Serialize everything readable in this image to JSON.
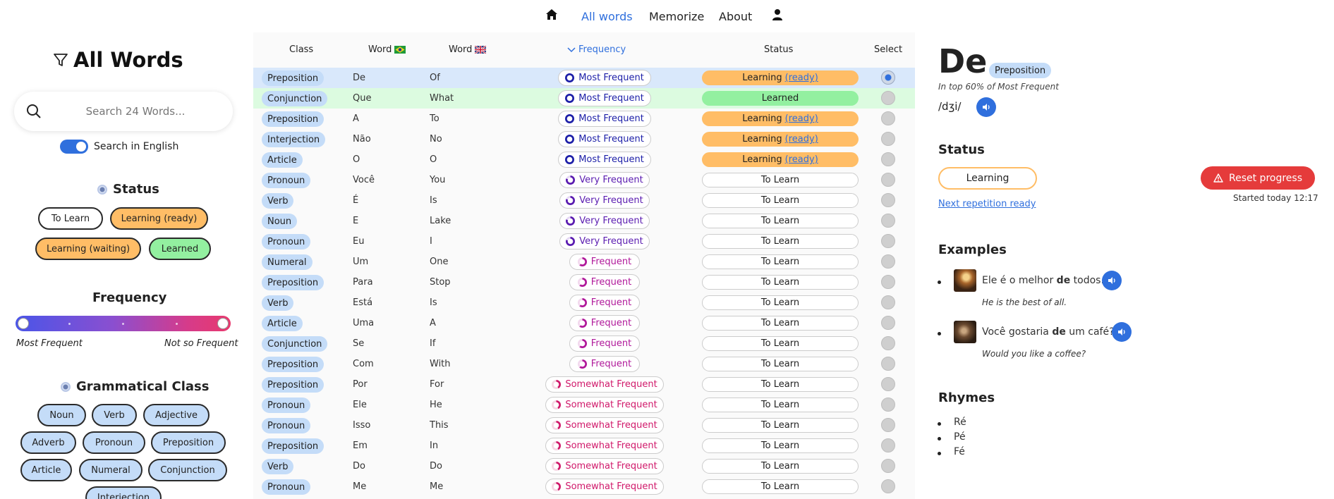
{
  "nav": {
    "home_icon": "home-icon",
    "links": [
      "All words",
      "Memorize",
      "About"
    ],
    "active": "All words",
    "user_icon": "user-icon"
  },
  "sidebar": {
    "title": "All Words",
    "title_icon": "filter-icon",
    "search_placeholder": "Search 24 Words...",
    "toggle_label": "Search in English",
    "toggle_on": true,
    "status_heading": "Status",
    "status_pills": [
      "To Learn",
      "Learning (ready)",
      "Learning (waiting)",
      "Learned"
    ],
    "frequency_heading": "Frequency",
    "frequency_min_label": "Most Frequent",
    "frequency_max_label": "Not so Frequent",
    "frequency_range": [
      0,
      1
    ],
    "class_heading": "Grammatical Class",
    "class_pills": [
      "Noun",
      "Verb",
      "Adjective",
      "Adverb",
      "Pronoun",
      "Preposition",
      "Article",
      "Numeral",
      "Conjunction",
      "Interjection"
    ]
  },
  "table": {
    "headers": {
      "class": "Class",
      "word_pt": "Word",
      "word_en": "Word",
      "frequency": "Frequency",
      "status": "Status",
      "select": "Select"
    },
    "rows": [
      {
        "class": "Preposition",
        "pt": "De",
        "en": "Of",
        "freq": "Most Frequent",
        "status": "Learning",
        "ready": "(ready)"
      },
      {
        "class": "Conjunction",
        "pt": "Que",
        "en": "What",
        "freq": "Most Frequent",
        "status": "Learned",
        "ready": ""
      },
      {
        "class": "Preposition",
        "pt": "A",
        "en": "To",
        "freq": "Most Frequent",
        "status": "Learning",
        "ready": "(ready)"
      },
      {
        "class": "Interjection",
        "pt": "Não",
        "en": "No",
        "freq": "Most Frequent",
        "status": "Learning",
        "ready": "(ready)"
      },
      {
        "class": "Article",
        "pt": "O",
        "en": "O",
        "freq": "Most Frequent",
        "status": "Learning",
        "ready": "(ready)"
      },
      {
        "class": "Pronoun",
        "pt": "Você",
        "en": "You",
        "freq": "Very Frequent",
        "status": "To Learn",
        "ready": ""
      },
      {
        "class": "Verb",
        "pt": "É",
        "en": "Is",
        "freq": "Very Frequent",
        "status": "To Learn",
        "ready": ""
      },
      {
        "class": "Noun",
        "pt": "E",
        "en": "Lake",
        "freq": "Very Frequent",
        "status": "To Learn",
        "ready": ""
      },
      {
        "class": "Pronoun",
        "pt": "Eu",
        "en": "I",
        "freq": "Very Frequent",
        "status": "To Learn",
        "ready": ""
      },
      {
        "class": "Numeral",
        "pt": "Um",
        "en": "One",
        "freq": "Frequent",
        "status": "To Learn",
        "ready": ""
      },
      {
        "class": "Preposition",
        "pt": "Para",
        "en": "Stop",
        "freq": "Frequent",
        "status": "To Learn",
        "ready": ""
      },
      {
        "class": "Verb",
        "pt": "Está",
        "en": "Is",
        "freq": "Frequent",
        "status": "To Learn",
        "ready": ""
      },
      {
        "class": "Article",
        "pt": "Uma",
        "en": "A",
        "freq": "Frequent",
        "status": "To Learn",
        "ready": ""
      },
      {
        "class": "Conjunction",
        "pt": "Se",
        "en": "If",
        "freq": "Frequent",
        "status": "To Learn",
        "ready": ""
      },
      {
        "class": "Preposition",
        "pt": "Com",
        "en": "With",
        "freq": "Frequent",
        "status": "To Learn",
        "ready": ""
      },
      {
        "class": "Preposition",
        "pt": "Por",
        "en": "For",
        "freq": "Somewhat Frequent",
        "status": "To Learn",
        "ready": ""
      },
      {
        "class": "Pronoun",
        "pt": "Ele",
        "en": "He",
        "freq": "Somewhat Frequent",
        "status": "To Learn",
        "ready": ""
      },
      {
        "class": "Pronoun",
        "pt": "Isso",
        "en": "This",
        "freq": "Somewhat Frequent",
        "status": "To Learn",
        "ready": ""
      },
      {
        "class": "Preposition",
        "pt": "Em",
        "en": "In",
        "freq": "Somewhat Frequent",
        "status": "To Learn",
        "ready": ""
      },
      {
        "class": "Verb",
        "pt": "Do",
        "en": "Do",
        "freq": "Somewhat Frequent",
        "status": "To Learn",
        "ready": ""
      },
      {
        "class": "Pronoun",
        "pt": "Me",
        "en": "Me",
        "freq": "Somewhat Frequent",
        "status": "To Learn",
        "ready": ""
      }
    ],
    "selected_row": 0
  },
  "detail": {
    "word": "De",
    "class": "Preposition",
    "rank": "In top 60% of Most Frequent",
    "ipa": "/dʒi/",
    "status_heading": "Status",
    "status": "Learning",
    "next_link": "Next repetition ready",
    "reset_label": "Reset progress",
    "started": "Started today 12:17",
    "examples_heading": "Examples",
    "examples": [
      {
        "before": "Ele é o melhor ",
        "word": "de",
        "after": " todos.",
        "translation": "He is the best of all."
      },
      {
        "before": "Você gostaria ",
        "word": "de",
        "after": " um café?",
        "translation": "Would you like a coffee?"
      }
    ],
    "rhymes_heading": "Rhymes",
    "rhymes": [
      "Ré",
      "Pé",
      "Fé"
    ]
  },
  "colors": {
    "accent": "#2f6fdd",
    "learning": "#ffbd66",
    "learned": "#93f0a0",
    "class_badge": "#c4dcf8",
    "reset": "#e53b3b",
    "most_frequent": "#1d1fa8",
    "very_frequent": "#5a1bb0",
    "frequent": "#b0189a",
    "somewhat_frequent": "#d0186a"
  }
}
